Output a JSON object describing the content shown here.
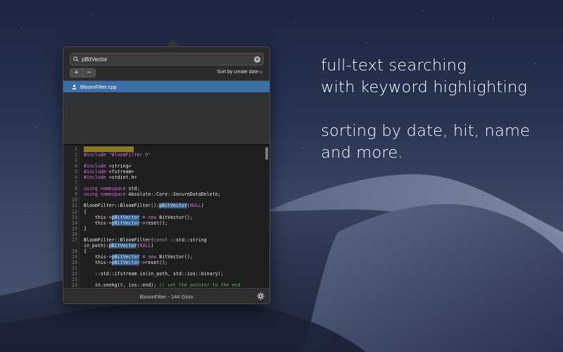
{
  "search": {
    "value": "pBitVector",
    "placeholder": "Search"
  },
  "toolbar": {
    "add_label": "+",
    "remove_label": "−",
    "sort_label": "Sort by create date",
    "sort_chevron": "◇"
  },
  "list": {
    "items": [
      {
        "name": "BloomFilter.cpp",
        "selected": true
      }
    ]
  },
  "code": {
    "lines": [
      {
        "n": "1",
        "parts": [
          {
            "t": "// BloomFilter.cpp",
            "c": "hlc"
          }
        ]
      },
      {
        "n": "2",
        "parts": [
          {
            "t": "#include ",
            "c": "kw"
          },
          {
            "t": "\"BloomFilter.h\"",
            "c": "kw"
          }
        ]
      },
      {
        "n": "3",
        "parts": []
      },
      {
        "n": "4",
        "parts": [
          {
            "t": "#include ",
            "c": "kw"
          },
          {
            "t": "<string>",
            "c": ""
          }
        ]
      },
      {
        "n": "5",
        "parts": [
          {
            "t": "#include ",
            "c": "kw"
          },
          {
            "t": "<fstream>",
            "c": ""
          }
        ]
      },
      {
        "n": "6",
        "parts": [
          {
            "t": "#include ",
            "c": "kw"
          },
          {
            "t": "<stdint.h>",
            "c": ""
          }
        ]
      },
      {
        "n": "7",
        "parts": []
      },
      {
        "n": "8",
        "parts": [
          {
            "t": "using namespace ",
            "c": "kw"
          },
          {
            "t": "std;",
            "c": ""
          }
        ]
      },
      {
        "n": "9",
        "parts": [
          {
            "t": "using namespace ",
            "c": "kw"
          },
          {
            "t": "Absolute::Core::SecureDataDelete;",
            "c": ""
          }
        ]
      },
      {
        "n": "10",
        "parts": []
      },
      {
        "n": "11",
        "parts": [
          {
            "t": "BloomFilter::BloomFilter():",
            "c": ""
          },
          {
            "t": "pBitVector",
            "c": "hl"
          },
          {
            "t": "(",
            "c": ""
          },
          {
            "t": "NULL",
            "c": "kw"
          },
          {
            "t": ")",
            "c": ""
          }
        ]
      },
      {
        "n": "12",
        "parts": [
          {
            "t": "{",
            "c": ""
          }
        ]
      },
      {
        "n": "13",
        "parts": [
          {
            "t": "    this->",
            "c": ""
          },
          {
            "t": "pBitVector",
            "c": "hl"
          },
          {
            "t": " = ",
            "c": ""
          },
          {
            "t": "new",
            "c": "kw"
          },
          {
            "t": " BitVector();",
            "c": ""
          }
        ]
      },
      {
        "n": "14",
        "parts": [
          {
            "t": "    this->",
            "c": ""
          },
          {
            "t": "pBitVector",
            "c": "hl"
          },
          {
            "t": "->reset();",
            "c": ""
          }
        ]
      },
      {
        "n": "15",
        "parts": [
          {
            "t": "}",
            "c": ""
          }
        ]
      },
      {
        "n": "16",
        "parts": []
      },
      {
        "n": "17",
        "parts": [
          {
            "t": "BloomFilter::BloomFilter(",
            "c": ""
          },
          {
            "t": "const",
            "c": "kw"
          },
          {
            "t": " ::std::string",
            "c": ""
          }
        ]
      },
      {
        "n": "",
        "parts": [
          {
            "t": "in_path):",
            "c": ""
          },
          {
            "t": "pBitVector",
            "c": "hl"
          },
          {
            "t": "(",
            "c": ""
          },
          {
            "t": "NULL",
            "c": "kw"
          },
          {
            "t": ")",
            "c": ""
          }
        ]
      },
      {
        "n": "18",
        "parts": [
          {
            "t": "{",
            "c": ""
          }
        ]
      },
      {
        "n": "19",
        "parts": [
          {
            "t": "    this->",
            "c": ""
          },
          {
            "t": "pBitVector",
            "c": "hl"
          },
          {
            "t": " = ",
            "c": ""
          },
          {
            "t": "new",
            "c": "kw"
          },
          {
            "t": " BitVector();",
            "c": ""
          }
        ]
      },
      {
        "n": "20",
        "parts": [
          {
            "t": "    this->",
            "c": ""
          },
          {
            "t": "pBitVector",
            "c": "hl"
          },
          {
            "t": "->reset();",
            "c": ""
          }
        ]
      },
      {
        "n": "21",
        "parts": []
      },
      {
        "n": "22",
        "parts": [
          {
            "t": "    ::std::ifstream in(in_path, std::ios::binary);",
            "c": ""
          }
        ]
      },
      {
        "n": "23",
        "parts": []
      },
      {
        "n": "24",
        "parts": [
          {
            "t": "    in.seekg(",
            "c": ""
          },
          {
            "t": "0",
            "c": "kw"
          },
          {
            "t": ", ios::end); ",
            "c": ""
          },
          {
            "t": "// set the pointer to the end",
            "c": "cm"
          }
        ]
      }
    ]
  },
  "footer": {
    "label": "BloomFilter - 144 Gists"
  },
  "marketing": {
    "blocks": [
      [
        "full-text searching",
        "with keyword highlighting"
      ],
      [
        "sorting by date, hit, name",
        "and more."
      ]
    ]
  },
  "colors": {
    "selection": "#3a6fa8",
    "keyword": "#d26fd4",
    "comment": "#5fb048",
    "match": "#2f5c8f"
  }
}
